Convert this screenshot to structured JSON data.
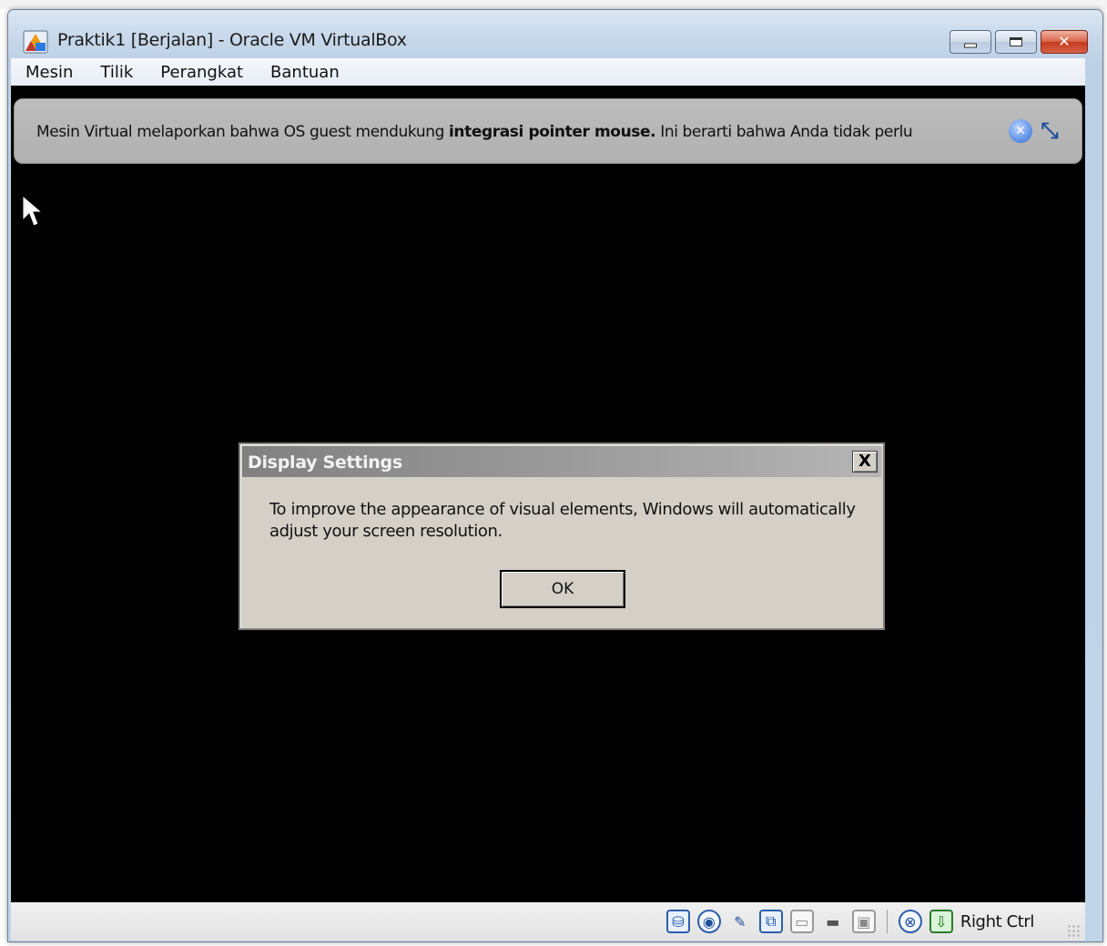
{
  "window": {
    "title": "Praktik1 [Berjalan] - Oracle VM VirtualBox",
    "close_symbol": "✕"
  },
  "menu": {
    "items": [
      "Mesin",
      "Tilik",
      "Perangkat",
      "Bantuan"
    ]
  },
  "notice": {
    "text_before": "Mesin Virtual melaporkan bahwa OS guest mendukung ",
    "bold": "integrasi pointer mouse.",
    "text_after": " Ini berarti bahwa Anda tidak perlu",
    "icons": [
      "close-icon",
      "mouse-integration-icon"
    ]
  },
  "dialog": {
    "title": "Display Settings",
    "close_symbol": "X",
    "message": "To improve the appearance of visual elements, Windows will automatically adjust your screen resolution.",
    "ok_label": "OK"
  },
  "statusbar": {
    "icons": [
      "hard-disk-icon",
      "optical-drive-icon",
      "usb-icon",
      "network-icon",
      "shared-folders-icon",
      "display-icon",
      "video-capture-icon",
      "mouse-integration-icon",
      "host-key-icon"
    ],
    "host_key": "Right Ctrl"
  },
  "colors": {
    "vm_background": "#000000",
    "notice_background": "#b8b8b8",
    "dialog_background": "#d4d0c8",
    "title_gradient_start": "#808080"
  }
}
